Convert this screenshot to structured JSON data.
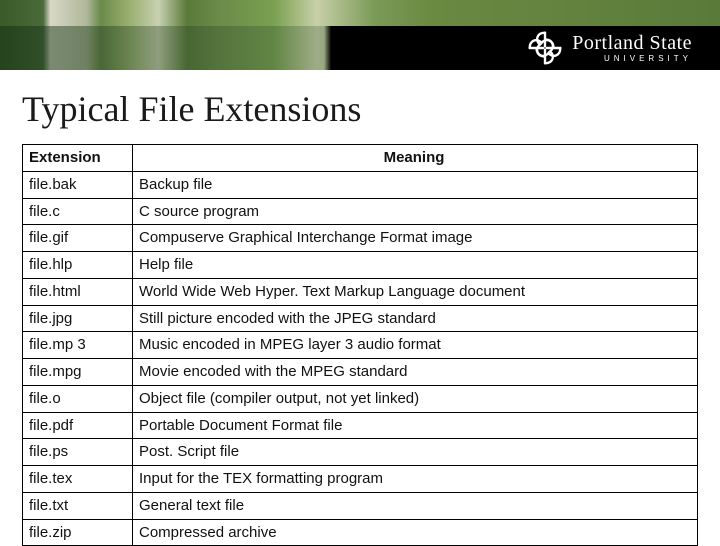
{
  "brand": {
    "title": "Portland State",
    "subtitle": "UNIVERSITY"
  },
  "slide": {
    "title": "Typical File Extensions"
  },
  "table": {
    "headers": {
      "extension": "Extension",
      "meaning": "Meaning"
    },
    "rows": [
      {
        "ext": "file.bak",
        "meaning": "Backup file"
      },
      {
        "ext": "file.c",
        "meaning": "C source program"
      },
      {
        "ext": "file.gif",
        "meaning": "Compuserve Graphical Interchange Format image"
      },
      {
        "ext": "file.hlp",
        "meaning": "Help file"
      },
      {
        "ext": "file.html",
        "meaning": "World Wide Web Hyper. Text Markup Language document"
      },
      {
        "ext": "file.jpg",
        "meaning": "Still picture encoded with the JPEG standard"
      },
      {
        "ext": "file.mp 3",
        "meaning": "Music encoded in MPEG layer 3 audio format"
      },
      {
        "ext": "file.mpg",
        "meaning": "Movie encoded with the MPEG standard"
      },
      {
        "ext": "file.o",
        "meaning": "Object file (compiler output, not yet linked)"
      },
      {
        "ext": "file.pdf",
        "meaning": "Portable Document Format file"
      },
      {
        "ext": "file.ps",
        "meaning": "Post. Script file"
      },
      {
        "ext": "file.tex",
        "meaning": "Input for the TEX formatting program"
      },
      {
        "ext": "file.txt",
        "meaning": "General text file"
      },
      {
        "ext": "file.zip",
        "meaning": "Compressed archive"
      }
    ]
  }
}
